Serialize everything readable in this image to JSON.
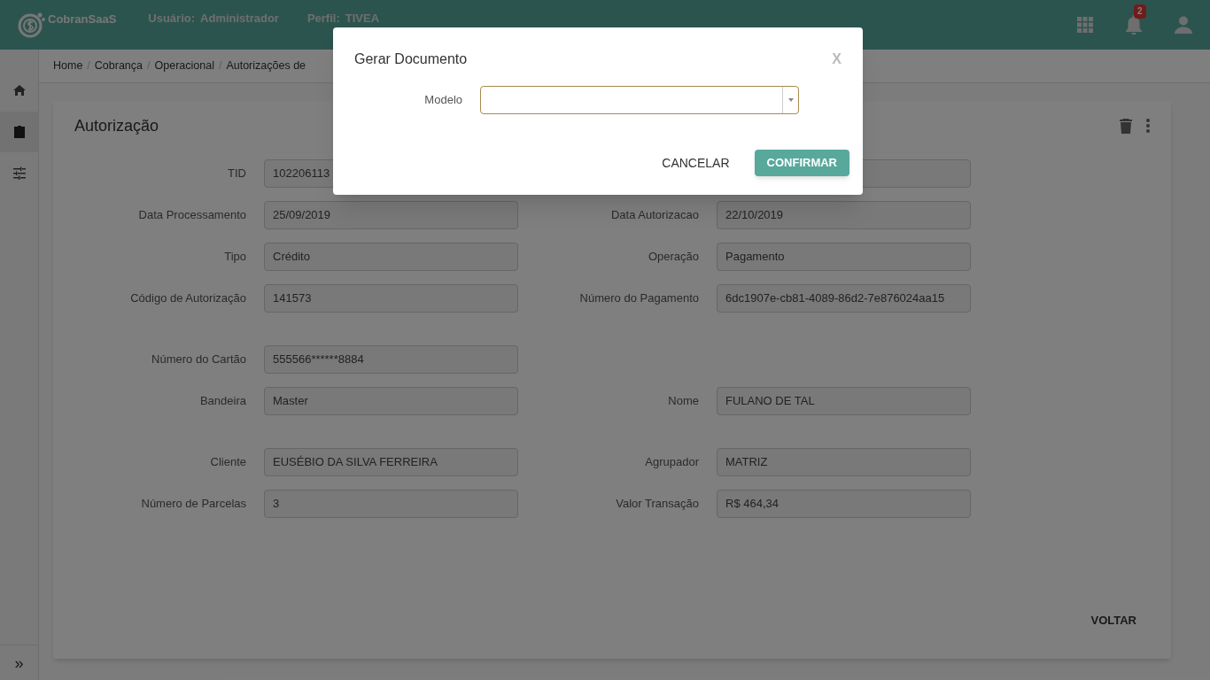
{
  "header": {
    "brand": "CobranSaaS",
    "user_label": "Usuário:",
    "user": "Administrador",
    "profile_label": "Perfil:",
    "profile": "TIVEA",
    "notifications": "2"
  },
  "sidebar": {
    "items": [
      {
        "kind": "home",
        "selected": false
      },
      {
        "kind": "clipboard",
        "selected": true
      },
      {
        "kind": "sliders",
        "selected": false
      }
    ],
    "expand": "»"
  },
  "breadcrumb": {
    "separator": "/",
    "items": [
      "Home",
      "Cobrança",
      "Operacional",
      "Autorizações de"
    ]
  },
  "card": {
    "title": "Autorização",
    "back_button": "VOLTAR",
    "groups": [
      [
        {
          "left": {
            "label": "TID",
            "value": "102206113"
          },
          "right": {
            "kind": "blank"
          }
        },
        {
          "left": {
            "label": "Data Processamento",
            "value": "25/09/2019"
          },
          "right": {
            "label": "Data Autorizacao",
            "value": "22/10/2019"
          }
        },
        {
          "left": {
            "label": "Tipo",
            "value": "Crédito"
          },
          "right": {
            "label": "Operação",
            "value": "Pagamento"
          }
        },
        {
          "left": {
            "label": "Código de Autorização",
            "value": "141573"
          },
          "right": {
            "label": "Número do Pagamento",
            "value": "6dc1907e-cb81-4089-86d2-7e876024aa15"
          }
        }
      ],
      [
        {
          "left": {
            "label": "Número do Cartão",
            "value": "555566******8884"
          }
        },
        {
          "left": {
            "label": "Bandeira",
            "value": "Master"
          },
          "right": {
            "label": "Nome",
            "value": "FULANO DE TAL"
          }
        }
      ],
      [
        {
          "left": {
            "label": "Cliente",
            "value": "EUSÉBIO DA SILVA FERREIRA"
          },
          "right": {
            "label": "Agrupador",
            "value": "MATRIZ"
          }
        },
        {
          "left": {
            "label": "Número de Parcelas",
            "value": "3"
          },
          "right": {
            "label": "Valor Transação",
            "value": "R$ 464,34"
          }
        }
      ]
    ]
  },
  "dialog": {
    "title": "Gerar Documento",
    "close": "X",
    "field_label": "Modelo",
    "buttons": [
      {
        "label": "CANCELAR",
        "kind": "text"
      },
      {
        "label": "CONFIRMAR",
        "kind": "primary"
      }
    ]
  }
}
